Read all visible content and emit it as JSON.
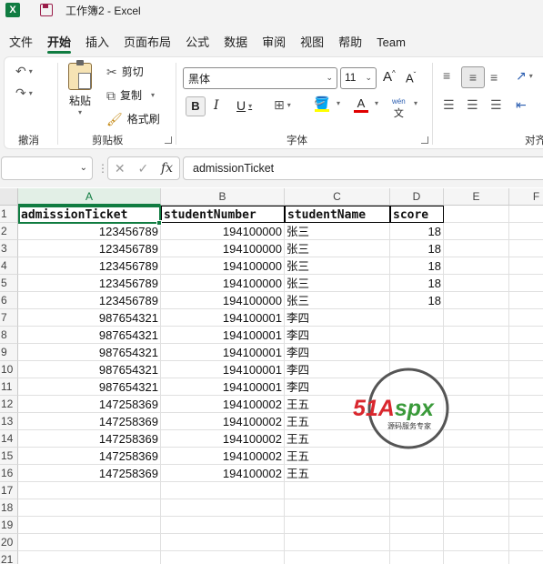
{
  "window": {
    "title": "工作簿2  -  Excel",
    "app_icon": "excel-icon",
    "save_icon": "save-icon"
  },
  "menu": {
    "tabs": [
      "文件",
      "开始",
      "插入",
      "页面布局",
      "公式",
      "数据",
      "审阅",
      "视图",
      "帮助",
      "Team"
    ],
    "active": "开始"
  },
  "ribbon": {
    "undo_group_label": "撤消",
    "clipboard": {
      "label": "剪贴板",
      "paste": "粘贴",
      "cut": "剪切",
      "copy": "复制",
      "format_painter": "格式刷"
    },
    "font": {
      "label": "字体",
      "name": "黑体",
      "size": "11",
      "bold": "B",
      "italic": "I",
      "underline": "U",
      "font_color_letter": "A",
      "phonetic": "wén"
    },
    "alignment": {
      "label": "对齐"
    }
  },
  "formula_bar": {
    "name_box": "",
    "fx": "fx",
    "content": "admissionTicket"
  },
  "sheet": {
    "columns": [
      "A",
      "B",
      "C",
      "D",
      "E",
      "F"
    ],
    "row_numbers": [
      "1",
      "2",
      "3",
      "4",
      "5",
      "6",
      "7",
      "8",
      "9",
      "10",
      "11",
      "12",
      "13",
      "14",
      "15",
      "16",
      "17",
      "18",
      "19",
      "20",
      "21"
    ],
    "header": [
      "admissionTicket",
      "studentNumber",
      "studentName",
      "score"
    ],
    "rows": [
      [
        "123456789",
        "194100000",
        "张三",
        "18"
      ],
      [
        "123456789",
        "194100000",
        "张三",
        "18"
      ],
      [
        "123456789",
        "194100000",
        "张三",
        "18"
      ],
      [
        "123456789",
        "194100000",
        "张三",
        "18"
      ],
      [
        "123456789",
        "194100000",
        "张三",
        "18"
      ],
      [
        "987654321",
        "194100001",
        "李四",
        ""
      ],
      [
        "987654321",
        "194100001",
        "李四",
        ""
      ],
      [
        "987654321",
        "194100001",
        "李四",
        ""
      ],
      [
        "987654321",
        "194100001",
        "李四",
        ""
      ],
      [
        "987654321",
        "194100001",
        "李四",
        ""
      ],
      [
        "147258369",
        "194100002",
        "王五",
        ""
      ],
      [
        "147258369",
        "194100002",
        "王五",
        ""
      ],
      [
        "147258369",
        "194100002",
        "王五",
        ""
      ],
      [
        "147258369",
        "194100002",
        "王五",
        ""
      ],
      [
        "147258369",
        "194100002",
        "王五",
        ""
      ]
    ]
  },
  "watermark": {
    "brand": "51Aspx",
    "tagline": "源码服务专家"
  },
  "colors": {
    "accent": "#107c41",
    "watermark_red": "#d9272e",
    "watermark_green": "#3a9a3a"
  }
}
